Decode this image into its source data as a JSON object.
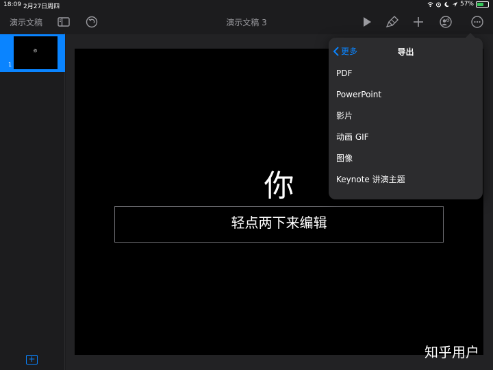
{
  "status_bar": {
    "time": "18:09",
    "date": "2月27日周四",
    "battery": "57%",
    "battery_level": 0.57
  },
  "toolbar": {
    "app_title": "演示文稿",
    "doc_title": "演示文稿 3",
    "icons": [
      "sidebar-toggle-icon",
      "undo-icon",
      "play-icon",
      "format-brush-icon",
      "add-icon",
      "collaborate-icon",
      "more-icon"
    ]
  },
  "sidebar": {
    "slides": [
      {
        "number": "1",
        "mini_text": "你"
      }
    ]
  },
  "slide": {
    "title": "你",
    "body_placeholder": "轻点两下来编辑"
  },
  "export_popover": {
    "back_label": "更多",
    "title": "导出",
    "items": [
      "PDF",
      "PowerPoint",
      "影片",
      "动画 GIF",
      "图像",
      "Keynote 讲演主题"
    ]
  },
  "watermark": "知乎用户",
  "colors": {
    "accent": "#0a84ff",
    "background": "#1c1c1e",
    "slide_bg": "#000000",
    "popover_bg": "#2c2c2e"
  }
}
